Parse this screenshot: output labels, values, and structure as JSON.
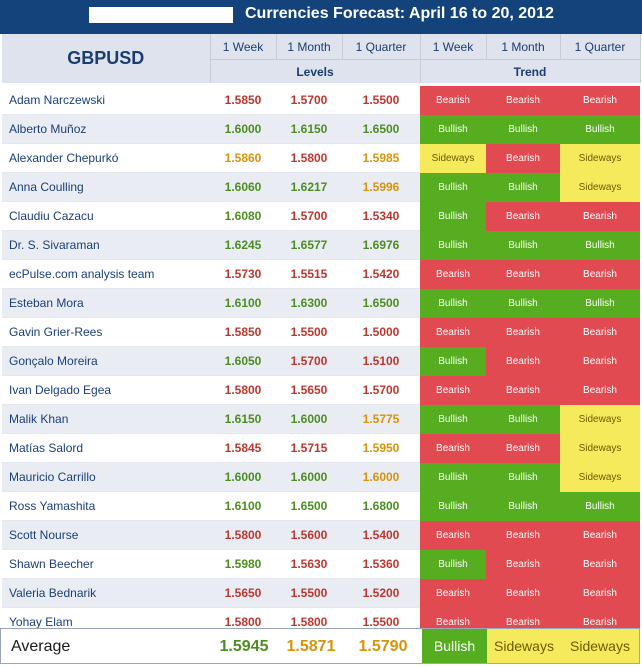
{
  "title": "Currencies Forecast: April 16 to 20, 2012",
  "pair": "GBPUSD",
  "columns": {
    "levels": [
      "1 Week",
      "1 Month",
      "1 Quarter"
    ],
    "trend": [
      "1 Week",
      "1 Month",
      "1 Quarter"
    ],
    "levels_group": "Levels",
    "trend_group": "Trend"
  },
  "colors": {
    "bearish": "#e04a50",
    "bullish": "#55ad1f",
    "sideways": "#f5ea5c",
    "header_bg": "#14427a"
  },
  "rows": [
    {
      "name": "Adam Narczewski",
      "levels": [
        "1.5850",
        "1.5700",
        "1.5500"
      ],
      "trend": [
        "Bearish",
        "Bearish",
        "Bearish"
      ]
    },
    {
      "name": "Alberto Muñoz",
      "levels": [
        "1.6000",
        "1.6150",
        "1.6500"
      ],
      "trend": [
        "Bullish",
        "Bullish",
        "Bullish"
      ]
    },
    {
      "name": "Alexander Chepurkó",
      "levels": [
        "1.5860",
        "1.5800",
        "1.5985"
      ],
      "trend": [
        "Sideways",
        "Bearish",
        "Sideways"
      ]
    },
    {
      "name": "Anna Coulling",
      "levels": [
        "1.6060",
        "1.6217",
        "1.5996"
      ],
      "trend": [
        "Bullish",
        "Bullish",
        "Sideways"
      ]
    },
    {
      "name": "Claudiu Cazacu",
      "levels": [
        "1.6080",
        "1.5700",
        "1.5340"
      ],
      "trend": [
        "Bullish",
        "Bearish",
        "Bearish"
      ]
    },
    {
      "name": "Dr. S. Sivaraman",
      "levels": [
        "1.6245",
        "1.6577",
        "1.6976"
      ],
      "trend": [
        "Bullish",
        "Bullish",
        "Bullish"
      ]
    },
    {
      "name": "ecPulse.com analysis team",
      "levels": [
        "1.5730",
        "1.5515",
        "1.5420"
      ],
      "trend": [
        "Bearish",
        "Bearish",
        "Bearish"
      ]
    },
    {
      "name": "Esteban Mora",
      "levels": [
        "1.6100",
        "1.6300",
        "1.6500"
      ],
      "trend": [
        "Bullish",
        "Bullish",
        "Bullish"
      ]
    },
    {
      "name": "Gavin Grier-Rees",
      "levels": [
        "1.5850",
        "1.5500",
        "1.5000"
      ],
      "trend": [
        "Bearish",
        "Bearish",
        "Bearish"
      ]
    },
    {
      "name": "Gonçalo Moreira",
      "levels": [
        "1.6050",
        "1.5700",
        "1.5100"
      ],
      "trend": [
        "Bullish",
        "Bearish",
        "Bearish"
      ]
    },
    {
      "name": "Ivan Delgado Egea",
      "levels": [
        "1.5800",
        "1.5650",
        "1.5700"
      ],
      "trend": [
        "Bearish",
        "Bearish",
        "Bearish"
      ]
    },
    {
      "name": "Malik Khan",
      "levels": [
        "1.6150",
        "1.6000",
        "1.5775"
      ],
      "trend": [
        "Bullish",
        "Bullish",
        "Sideways"
      ]
    },
    {
      "name": "Matías Salord",
      "levels": [
        "1.5845",
        "1.5715",
        "1.5950"
      ],
      "trend": [
        "Bearish",
        "Bearish",
        "Sideways"
      ]
    },
    {
      "name": "Mauricio Carrillo",
      "levels": [
        "1.6000",
        "1.6000",
        "1.6000"
      ],
      "trend": [
        "Bullish",
        "Bullish",
        "Sideways"
      ]
    },
    {
      "name": "Ross Yamashita",
      "levels": [
        "1.6100",
        "1.6500",
        "1.6800"
      ],
      "trend": [
        "Bullish",
        "Bullish",
        "Bullish"
      ]
    },
    {
      "name": "Scott Nourse",
      "levels": [
        "1.5800",
        "1.5600",
        "1.5400"
      ],
      "trend": [
        "Bearish",
        "Bearish",
        "Bearish"
      ]
    },
    {
      "name": "Shawn Beecher",
      "levels": [
        "1.5980",
        "1.5630",
        "1.5360"
      ],
      "trend": [
        "Bullish",
        "Bearish",
        "Bearish"
      ]
    },
    {
      "name": "Valeria Bednarik",
      "levels": [
        "1.5650",
        "1.5500",
        "1.5200"
      ],
      "trend": [
        "Bearish",
        "Bearish",
        "Bearish"
      ]
    },
    {
      "name": "Yohay Elam",
      "levels": [
        "1.5800",
        "1.5800",
        "1.5500"
      ],
      "trend": [
        "Bearish",
        "Bearish",
        "Bearish"
      ]
    }
  ],
  "level_colors": [
    [
      "bear",
      "bear",
      "bear"
    ],
    [
      "bull",
      "bull",
      "bull"
    ],
    [
      "side",
      "bear",
      "side"
    ],
    [
      "bull",
      "bull",
      "side"
    ],
    [
      "bull",
      "bear",
      "bear"
    ],
    [
      "bull",
      "bull",
      "bull"
    ],
    [
      "bear",
      "bear",
      "bear"
    ],
    [
      "bull",
      "bull",
      "bull"
    ],
    [
      "bear",
      "bear",
      "bear"
    ],
    [
      "bull",
      "bear",
      "bear"
    ],
    [
      "bear",
      "bear",
      "bear"
    ],
    [
      "bull",
      "bull",
      "side"
    ],
    [
      "bear",
      "bear",
      "side"
    ],
    [
      "bull",
      "bull",
      "side"
    ],
    [
      "bull",
      "bull",
      "bull"
    ],
    [
      "bear",
      "bear",
      "bear"
    ],
    [
      "bull",
      "bear",
      "bear"
    ],
    [
      "bear",
      "bear",
      "bear"
    ],
    [
      "bear",
      "bear",
      "bear"
    ]
  ],
  "average": {
    "label": "Average",
    "levels": [
      "1.5945",
      "1.5871",
      "1.5790"
    ],
    "level_colors": [
      "bull",
      "side",
      "side"
    ],
    "trend": [
      "Bullish",
      "Sideways",
      "Sideways"
    ]
  }
}
